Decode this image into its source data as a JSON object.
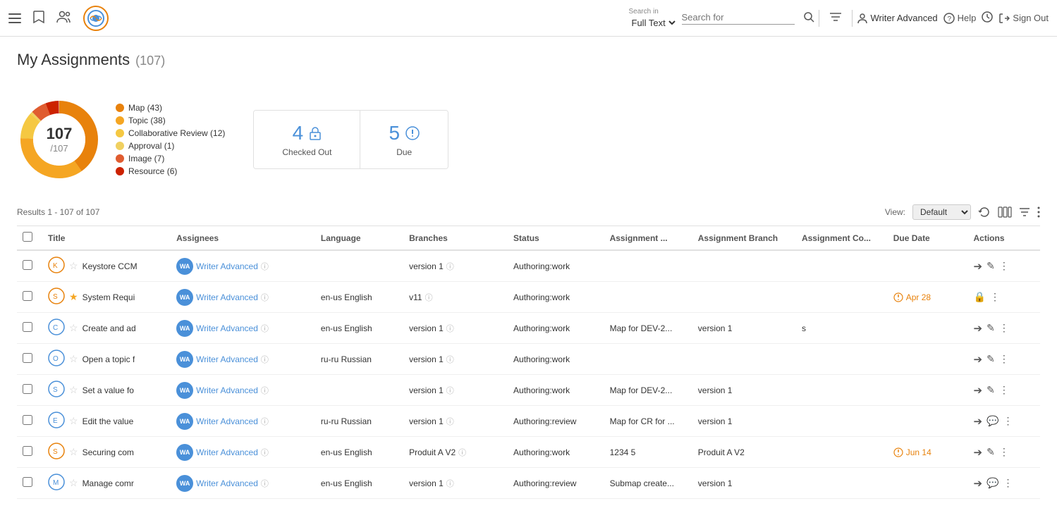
{
  "topnav": {
    "search_in_label": "Search in",
    "search_type": "Full Text",
    "search_placeholder": "Search for",
    "help_label": "Help",
    "signout_label": "Sign Out",
    "user_label": "Writer Advanced"
  },
  "page": {
    "title": "My Assignments",
    "count": "(107)",
    "results_text": "Results 1 - 107 of 107",
    "view_label": "View:",
    "view_default": "Default"
  },
  "chart": {
    "center_num": "107",
    "center_denom": "/107",
    "legend": [
      {
        "label": "Map (43)",
        "color": "#e8820c"
      },
      {
        "label": "Topic (38)",
        "color": "#f5a623"
      },
      {
        "label": "Collaborative Review (12)",
        "color": "#f5c842"
      },
      {
        "label": "Approval (1)",
        "color": "#f0d060"
      },
      {
        "label": "Image (7)",
        "color": "#e05c30"
      },
      {
        "label": "Resource (6)",
        "color": "#cc2200"
      }
    ]
  },
  "stat_boxes": [
    {
      "num": "4",
      "label": "Checked Out",
      "icon": "lock"
    },
    {
      "num": "5",
      "label": "Due",
      "icon": "exclamation"
    }
  ],
  "table": {
    "columns": [
      "",
      "Title",
      "Assignees",
      "Language",
      "Branches",
      "Status",
      "Assignment ...",
      "Assignment Branch",
      "Assignment Co...",
      "Due Date",
      "Actions"
    ],
    "rows": [
      {
        "icon_type": "orange",
        "icon_letter": "K",
        "star": false,
        "title": "Keystore CCM",
        "assignee": "Writer Advanced",
        "language": "",
        "branch": "version 1",
        "status": "Authoring:work",
        "assignment": "",
        "assign_branch": "",
        "assign_co": "",
        "due": "",
        "has_arrow": true,
        "has_pencil": true
      },
      {
        "icon_type": "orange",
        "icon_letter": "S",
        "star": true,
        "title": "System Requi",
        "assignee": "Writer Advanced",
        "language": "en-us English",
        "branch": "v11",
        "status": "Authoring:work",
        "assignment": "",
        "assign_branch": "",
        "assign_co": "",
        "due": "Apr 28",
        "due_overdue": true,
        "has_arrow": false,
        "has_pencil": false,
        "has_lock": true
      },
      {
        "icon_type": "blue",
        "icon_letter": "C",
        "star": false,
        "title": "Create and ad",
        "assignee": "Writer Advanced",
        "language": "en-us English",
        "branch": "version 1",
        "status": "Authoring:work",
        "assignment": "Map for DEV-2...",
        "assign_branch": "version 1",
        "assign_co": "s",
        "due": "",
        "has_arrow": true,
        "has_pencil": true
      },
      {
        "icon_type": "blue",
        "icon_letter": "O",
        "star": false,
        "title": "Open a topic f",
        "assignee": "Writer Advanced",
        "language": "ru-ru Russian",
        "branch": "version 1",
        "status": "Authoring:work",
        "assignment": "",
        "assign_branch": "",
        "assign_co": "",
        "due": "",
        "has_arrow": true,
        "has_pencil": true
      },
      {
        "icon_type": "blue",
        "icon_letter": "S",
        "star": false,
        "title": "Set a value fo",
        "assignee": "Writer Advanced",
        "language": "",
        "branch": "version 1",
        "status": "Authoring:work",
        "assignment": "Map for DEV-2...",
        "assign_branch": "version 1",
        "assign_co": "",
        "due": "",
        "has_arrow": true,
        "has_pencil": true
      },
      {
        "icon_type": "blue",
        "icon_letter": "E",
        "star": false,
        "title": "Edit the value",
        "assignee": "Writer Advanced",
        "language": "ru-ru Russian",
        "branch": "version 1",
        "status": "Authoring:review",
        "assignment": "Map for CR for ...",
        "assign_branch": "version 1",
        "assign_co": "",
        "due": "",
        "has_arrow": true,
        "has_pencil": false,
        "has_comment": true
      },
      {
        "icon_type": "orange",
        "icon_letter": "S",
        "star": false,
        "title": "Securing com",
        "assignee": "Writer Advanced",
        "language": "en-us English",
        "branch": "Produit A V2",
        "status": "Authoring:work",
        "assignment": "1234 5",
        "assign_branch": "Produit A V2",
        "assign_co": "",
        "due": "Jun 14",
        "due_overdue": true,
        "has_arrow": true,
        "has_pencil": true
      },
      {
        "icon_type": "blue",
        "icon_letter": "M",
        "star": false,
        "title": "Manage comr",
        "assignee": "Writer Advanced",
        "language": "en-us English",
        "branch": "version 1",
        "status": "Authoring:review",
        "assignment": "Submap create...",
        "assign_branch": "version 1",
        "assign_co": "",
        "due": "",
        "has_arrow": true,
        "has_pencil": false,
        "has_comment": true
      }
    ]
  }
}
